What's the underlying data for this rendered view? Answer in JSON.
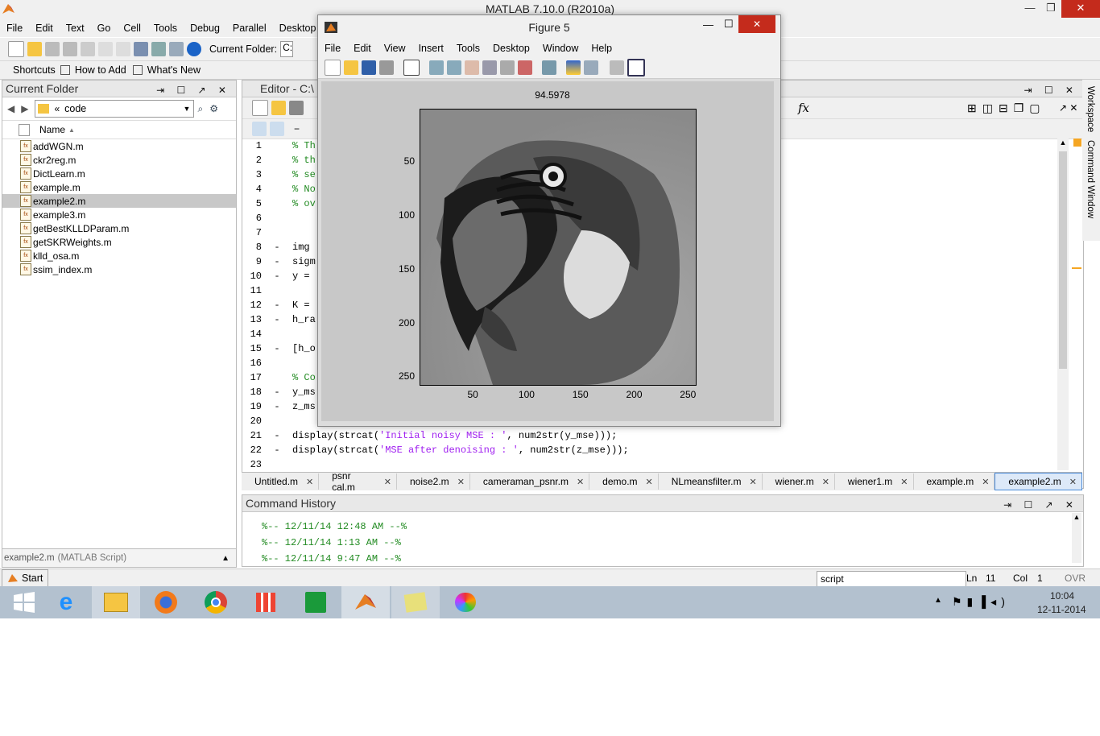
{
  "window": {
    "title": "MATLAB  7.10.0 (R2010a)"
  },
  "menubar": [
    "File",
    "Edit",
    "Text",
    "Go",
    "Cell",
    "Tools",
    "Debug",
    "Parallel",
    "Desktop"
  ],
  "toolbar": {
    "current_folder_label": "Current Folder:",
    "current_folder_value": "C:"
  },
  "shortcuts": {
    "label": "Shortcuts",
    "how_to_add": "How to Add",
    "whats_new": "What's New"
  },
  "current_folder": {
    "title": "Current Folder",
    "path": "code",
    "path_prefix": "«",
    "column_header": "Name",
    "files": [
      {
        "name": "addWGN.m",
        "selected": false
      },
      {
        "name": "ckr2reg.m",
        "selected": false
      },
      {
        "name": "DictLearn.m",
        "selected": false
      },
      {
        "name": "example.m",
        "selected": false
      },
      {
        "name": "example2.m",
        "selected": true
      },
      {
        "name": "example3.m",
        "selected": false
      },
      {
        "name": "getBestKLLDParam.m",
        "selected": false
      },
      {
        "name": "getSKRWeights.m",
        "selected": false
      },
      {
        "name": "klld_osa.m",
        "selected": false
      },
      {
        "name": "ssim_index.m",
        "selected": false
      }
    ],
    "details_name": "example2.m",
    "details_type": "(MATLAB Script)"
  },
  "editor": {
    "title": "Editor - C:\\",
    "fx_label": "fx",
    "lines": [
      {
        "n": "1",
        "dash": "",
        "code": "% Th"
      },
      {
        "n": "2",
        "dash": "",
        "code": "% th"
      },
      {
        "n": "3",
        "dash": "",
        "code": "% se"
      },
      {
        "n": "4",
        "dash": "",
        "code": "% No"
      },
      {
        "n": "5",
        "dash": "",
        "code": "% ov"
      },
      {
        "n": "6",
        "dash": "",
        "code": ""
      },
      {
        "n": "7",
        "dash": "",
        "code": ""
      },
      {
        "n": "8",
        "dash": "-",
        "code": "img"
      },
      {
        "n": "9",
        "dash": "-",
        "code": "sigm"
      },
      {
        "n": "10",
        "dash": "-",
        "code": "y ="
      },
      {
        "n": "11",
        "dash": "",
        "code": ""
      },
      {
        "n": "12",
        "dash": "-",
        "code": "K ="
      },
      {
        "n": "13",
        "dash": "-",
        "code": "h_ra"
      },
      {
        "n": "14",
        "dash": "",
        "code": ""
      },
      {
        "n": "15",
        "dash": "-",
        "code": "[h_o"
      },
      {
        "n": "16",
        "dash": "",
        "code": ""
      },
      {
        "n": "17",
        "dash": "",
        "code": "% Co"
      },
      {
        "n": "18",
        "dash": "-",
        "code": "y_ms"
      },
      {
        "n": "19",
        "dash": "-",
        "code": "z_ms"
      },
      {
        "n": "20",
        "dash": "",
        "code": ""
      },
      {
        "n": "21",
        "dash": "-",
        "code": "display(strcat(",
        "str": "'Initial noisy MSE : '",
        "rest": ", num2str(y_mse)));"
      },
      {
        "n": "22",
        "dash": "-",
        "code": "display(strcat(",
        "str": "'MSE after denoising : '",
        "rest": ", num2str(z_mse)));"
      },
      {
        "n": "23",
        "dash": "",
        "code": ""
      }
    ]
  },
  "tabs": [
    "Untitled.m",
    "psnr cal.m",
    "noise2.m",
    "cameraman_psnr.m",
    "demo.m",
    "NLmeansfilter.m",
    "wiener.m",
    "wiener1.m",
    "example.m",
    "example2.m"
  ],
  "active_tab": "example2.m",
  "command_history": {
    "title": "Command History",
    "lines": [
      "%-- 12/11/14 12:48 AM --%",
      "%-- 12/11/14  1:13 AM --%",
      "%-- 12/11/14  9:47 AM --%"
    ]
  },
  "status": {
    "start": "Start",
    "mode": "script",
    "ln_label": "Ln",
    "ln": "11",
    "col_label": "Col",
    "col": "1",
    "ovr": "OVR"
  },
  "side_tabs": {
    "workspace": "Workspace",
    "command_window": "Command Window"
  },
  "figure": {
    "title": "Figure 5",
    "menu": [
      "File",
      "Edit",
      "View",
      "Insert",
      "Tools",
      "Desktop",
      "Window",
      "Help"
    ],
    "plot_title": "94.5978",
    "xticks": [
      "50",
      "100",
      "150",
      "200",
      "250"
    ],
    "yticks": [
      "50",
      "100",
      "150",
      "200",
      "250"
    ]
  },
  "taskbar": {
    "time": "10:04",
    "date": "12-11-2014"
  },
  "colors": {
    "matlab_orange": "#e67e22",
    "selection": "#c8c8c8",
    "comment_green": "#228b22",
    "string_purple": "#a020f0",
    "close_red": "#c42b1c"
  }
}
